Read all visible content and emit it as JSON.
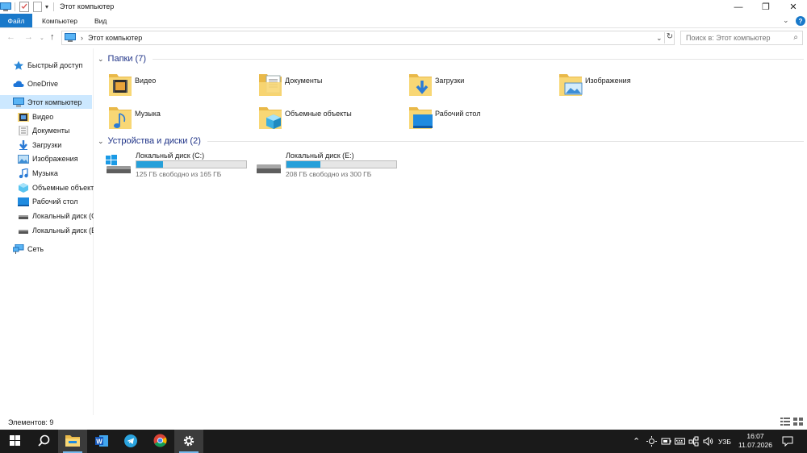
{
  "window": {
    "title": "Этот компьютер",
    "minimize_glyph": "—",
    "maximize_glyph": "❐",
    "close_glyph": "✕",
    "dropdown_glyph": "▾"
  },
  "ribbon": {
    "tabs": [
      "Файл",
      "Компьютер",
      "Вид"
    ],
    "expand_glyph": "⌄",
    "help_glyph": "?"
  },
  "address": {
    "path": "Этот компьютер",
    "chevron": "›",
    "search_placeholder": "Поиск в: Этот компьютер",
    "back_glyph": "←",
    "forward_glyph": "→",
    "up_glyph": "↑",
    "drop_glyph": "⌄",
    "refresh_glyph": "↻",
    "search_glyph": "⌕"
  },
  "sidebar": {
    "quick_access": "Быстрый доступ",
    "onedrive": "OneDrive",
    "this_pc": "Этот компьютер",
    "items": [
      {
        "label": "Видео",
        "icon": "video-folder-icon"
      },
      {
        "label": "Документы",
        "icon": "documents-folder-icon"
      },
      {
        "label": "Загрузки",
        "icon": "downloads-folder-icon"
      },
      {
        "label": "Изображения",
        "icon": "pictures-folder-icon"
      },
      {
        "label": "Музыка",
        "icon": "music-folder-icon"
      },
      {
        "label": "Объемные объекты",
        "icon": "3d-objects-folder-icon"
      },
      {
        "label": "Рабочий стол",
        "icon": "desktop-folder-icon"
      },
      {
        "label": "Локальный диск (C:)",
        "icon": "drive-icon"
      },
      {
        "label": "Локальный диск (E:)",
        "icon": "drive-icon"
      }
    ],
    "network": "Сеть"
  },
  "content": {
    "folders_header": "Папки (7)",
    "folders": [
      {
        "label": "Видео",
        "icon": "video-folder-icon"
      },
      {
        "label": "Документы",
        "icon": "documents-folder-icon"
      },
      {
        "label": "Загрузки",
        "icon": "downloads-folder-icon"
      },
      {
        "label": "Изображения",
        "icon": "pictures-folder-icon"
      },
      {
        "label": "Музыка",
        "icon": "music-folder-icon"
      },
      {
        "label": "Объемные объекты",
        "icon": "3d-objects-folder-icon"
      },
      {
        "label": "Рабочий стол",
        "icon": "desktop-folder-icon"
      }
    ],
    "drives_header": "Устройства и диски (2)",
    "drives": [
      {
        "label": "Локальный диск (C:)",
        "free": "125 ГБ свободно из 165 ГБ",
        "used_fraction": 0.24
      },
      {
        "label": "Локальный диск (E:)",
        "free": "208 ГБ свободно из 300 ГБ",
        "used_fraction": 0.31
      }
    ],
    "group_chevron": "⌄"
  },
  "status": {
    "items_count": "Элементов: 9"
  },
  "taskbar": {
    "pinned": [
      "start-icon",
      "search-icon",
      "file-explorer-icon",
      "word-icon",
      "telegram-icon",
      "chrome-icon",
      "settings-icon"
    ],
    "tray_up_glyph": "⌃",
    "language": "УЗБ",
    "time": "16:07",
    "date": "11.07.2026"
  },
  "colors": {
    "accent": "#1979ca",
    "selection": "#cce8ff",
    "drive_fill": "#26a0da",
    "folder_yellow": "#f8d775",
    "taskbar": "#1a1a1a"
  }
}
